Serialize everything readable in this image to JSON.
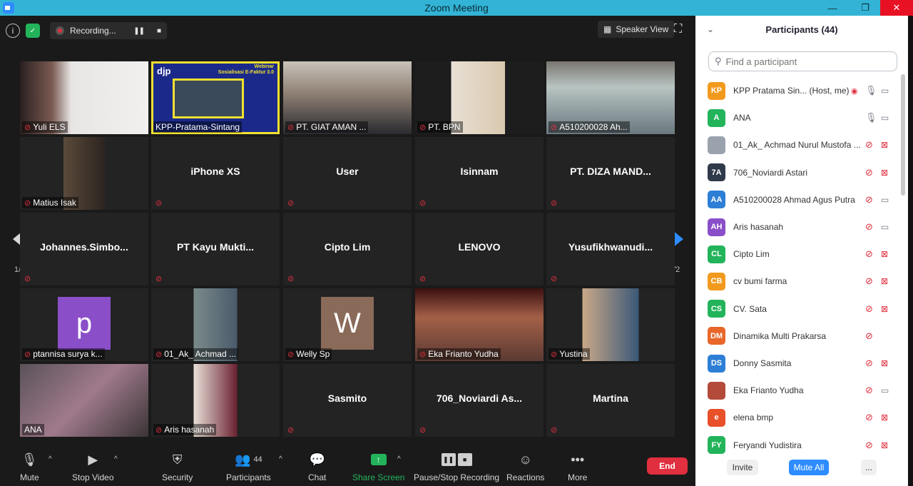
{
  "window": {
    "title": "Zoom Meeting",
    "minimize": "—",
    "maximize": "❐",
    "close": "✕"
  },
  "topbar": {
    "recording_label": "Recording...",
    "speaker_view_label": "Speaker View"
  },
  "pager": {
    "left": "1/2",
    "right": "1/2"
  },
  "tiles": [
    {
      "label": "Yuli ELS",
      "center": "",
      "kind": "video",
      "muted": true
    },
    {
      "label": "KPP-Pratama-Sintang",
      "center": "",
      "kind": "slide",
      "muted": false,
      "slide_logo": "djp",
      "slide_title": "Webinar",
      "slide_subtitle": "Sosialisasi E-Faktur 3.0"
    },
    {
      "label": "PT. GIAT AMAN ...",
      "center": "",
      "kind": "video",
      "muted": true
    },
    {
      "label": "PT. BPN",
      "center": "",
      "kind": "video",
      "muted": true
    },
    {
      "label": "A510200028 Ah...",
      "center": "",
      "kind": "video",
      "muted": true
    },
    {
      "label": "Matius Isak",
      "center": "",
      "kind": "video",
      "muted": true
    },
    {
      "label": "",
      "center": "iPhone  XS",
      "kind": "name",
      "muted": true
    },
    {
      "label": "",
      "center": "User",
      "kind": "name",
      "muted": true
    },
    {
      "label": "",
      "center": "Isinnam",
      "kind": "name",
      "muted": true
    },
    {
      "label": "",
      "center": "PT. DIZA MAND...",
      "kind": "name",
      "muted": true
    },
    {
      "label": "",
      "center": "Johannes.Simbo...",
      "kind": "name",
      "muted": true
    },
    {
      "label": "",
      "center": "PT  Kayu  Mukti...",
      "kind": "name",
      "muted": true
    },
    {
      "label": "",
      "center": "Cipto Lim",
      "kind": "name",
      "muted": true
    },
    {
      "label": "",
      "center": "LENOVO",
      "kind": "name",
      "muted": true
    },
    {
      "label": "",
      "center": "Yusufikhwanudi...",
      "kind": "name",
      "muted": true
    },
    {
      "label": "ptannisa surya k...",
      "center": "",
      "kind": "avatar",
      "muted": true,
      "avatar_letter": "p",
      "avatar_color": "#8a4fc8"
    },
    {
      "label": "01_Ak_ Achmad ...",
      "center": "",
      "kind": "video",
      "muted": true
    },
    {
      "label": "Welly Sp",
      "center": "",
      "kind": "avatar",
      "muted": true,
      "avatar_letter": "W",
      "avatar_color": "#8a6a58"
    },
    {
      "label": "Eka Frianto Yudha",
      "center": "",
      "kind": "video",
      "muted": true
    },
    {
      "label": "Yustina",
      "center": "",
      "kind": "video",
      "muted": true
    },
    {
      "label": "ANA",
      "center": "",
      "kind": "video",
      "muted": false
    },
    {
      "label": "Aris hasanah",
      "center": "",
      "kind": "video",
      "muted": true
    },
    {
      "label": "",
      "center": "Sasmito",
      "kind": "name",
      "muted": true
    },
    {
      "label": "",
      "center": "706_Noviardi As...",
      "kind": "name",
      "muted": true
    },
    {
      "label": "",
      "center": "Martina",
      "kind": "name",
      "muted": true
    }
  ],
  "toolbar": {
    "mute": "Mute",
    "stop_video": "Stop Video",
    "security": "Security",
    "participants": "Participants",
    "participants_count": "44",
    "chat": "Chat",
    "share_screen": "Share Screen",
    "pause_recording": "Pause/Stop Recording",
    "reactions": "Reactions",
    "more": "More",
    "end": "End"
  },
  "panel": {
    "title": "Participants (44)",
    "search_placeholder": "Find a participant",
    "participants": [
      {
        "initials": "KP",
        "color": "#f29a1e",
        "name": "KPP Pratama Sin...  (Host, me)",
        "mic": "on",
        "cam": "on",
        "recording": true
      },
      {
        "initials": "A",
        "color": "#23b45b",
        "name": "ANA",
        "mic": "on",
        "cam": "on"
      },
      {
        "initials": "",
        "color": "#9aa3ad",
        "name": "01_Ak_ Achmad Nurul Mustofa ...",
        "mic": "off",
        "cam": "off"
      },
      {
        "initials": "7A",
        "color": "#2f3a4a",
        "name": "706_Noviardi Astari",
        "mic": "off",
        "cam": "off"
      },
      {
        "initials": "AA",
        "color": "#2d7fd6",
        "name": "A510200028 Ahmad Agus Putra",
        "mic": "off",
        "cam": "on"
      },
      {
        "initials": "AH",
        "color": "#8a4fc8",
        "name": "Aris hasanah",
        "mic": "off",
        "cam": "on"
      },
      {
        "initials": "CL",
        "color": "#23b45b",
        "name": "Cipto Lim",
        "mic": "off",
        "cam": "off"
      },
      {
        "initials": "CB",
        "color": "#f29a1e",
        "name": "cv bumi farma",
        "mic": "off",
        "cam": "off"
      },
      {
        "initials": "CS",
        "color": "#23b45b",
        "name": "CV. Sata",
        "mic": "off",
        "cam": "off"
      },
      {
        "initials": "DM",
        "color": "#e8662a",
        "name": "Dinamika Multi Prakarsa",
        "mic": "off",
        "cam": "none"
      },
      {
        "initials": "DS",
        "color": "#2d7fd6",
        "name": "Donny Sasmita",
        "mic": "off",
        "cam": "off"
      },
      {
        "initials": "",
        "color": "#b34a3a",
        "name": "Eka Frianto Yudha",
        "mic": "off",
        "cam": "on"
      },
      {
        "initials": "e",
        "color": "#e8502a",
        "name": "elena bmp",
        "mic": "off",
        "cam": "off"
      },
      {
        "initials": "FY",
        "color": "#23b45b",
        "name": "Feryandi Yudistira",
        "mic": "off",
        "cam": "off"
      }
    ],
    "invite": "Invite",
    "mute_all": "Mute All",
    "more": "..."
  },
  "colors": {
    "accent": "#2d8cff",
    "danger": "#e02f3e",
    "active_speaker": "#f0e030",
    "titlebar": "#33b4d6"
  }
}
